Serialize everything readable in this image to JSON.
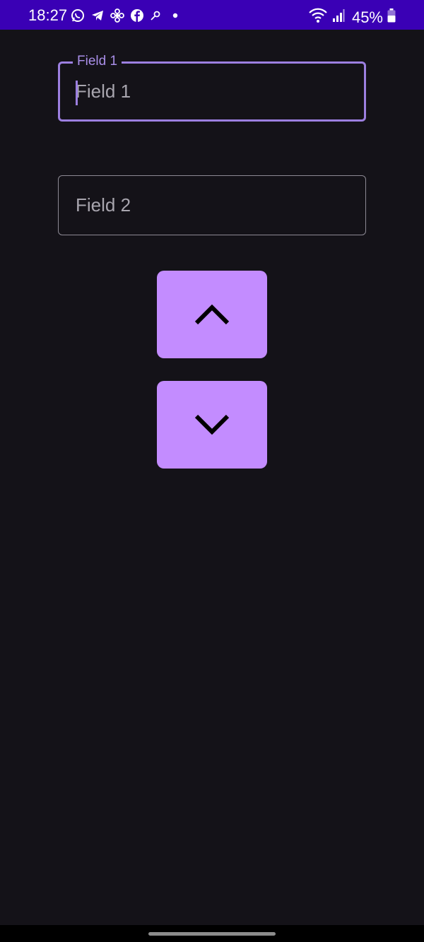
{
  "status_bar": {
    "time": "18:27",
    "battery": "45%",
    "left_icons": [
      "whatsapp-icon",
      "telegram-icon",
      "pinwheel-icon",
      "facebook-icon",
      "key-icon",
      "dot-icon"
    ],
    "right_icons": [
      "wifi-icon",
      "signal-icon",
      "battery-icon"
    ],
    "background_color": "#3a00b5"
  },
  "fields": [
    {
      "label": "Field 1",
      "placeholder": "Field 1",
      "value": "",
      "focused": true
    },
    {
      "label": "",
      "placeholder": "Field 2",
      "value": "",
      "focused": false
    }
  ],
  "buttons": {
    "up_icon": "chevron-up-icon",
    "down_icon": "chevron-down-icon",
    "color": "#c38cff"
  },
  "theme": {
    "background": "#141218",
    "accent": "#9c7fe0"
  }
}
